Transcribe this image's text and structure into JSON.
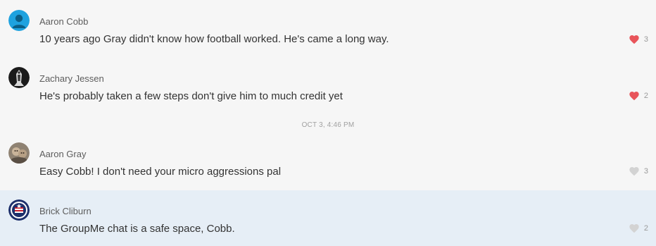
{
  "messages": [
    {
      "author": "Aaron Cobb",
      "text": "10 years ago Gray didn't know how football worked. He's came a long way.",
      "likes": "3",
      "liked": true,
      "avatar": "default-person-avatar"
    },
    {
      "author": "Zachary Jessen",
      "text": "He's probably taken a few steps don't give him to much credit yet",
      "likes": "2",
      "liked": true,
      "avatar": "dark-figure-avatar"
    },
    {
      "author": "Aaron Gray",
      "text": "Easy Cobb! I don't need your micro aggressions pal",
      "likes": "3",
      "liked": false,
      "avatar": "photo-avatar"
    },
    {
      "author": "Brick Cliburn",
      "text": "The GroupMe chat is a safe space, Cobb.",
      "likes": "2",
      "liked": false,
      "avatar": "emblem-avatar"
    }
  ],
  "timestamp": "OCT 3, 4:46 PM",
  "colors": {
    "background": "#f6f6f6",
    "highlight_row": "#e6eef6",
    "liked_heart": "#e8545a",
    "unliked_heart": "#d3d3d3",
    "default_avatar": "#1ea2df"
  }
}
